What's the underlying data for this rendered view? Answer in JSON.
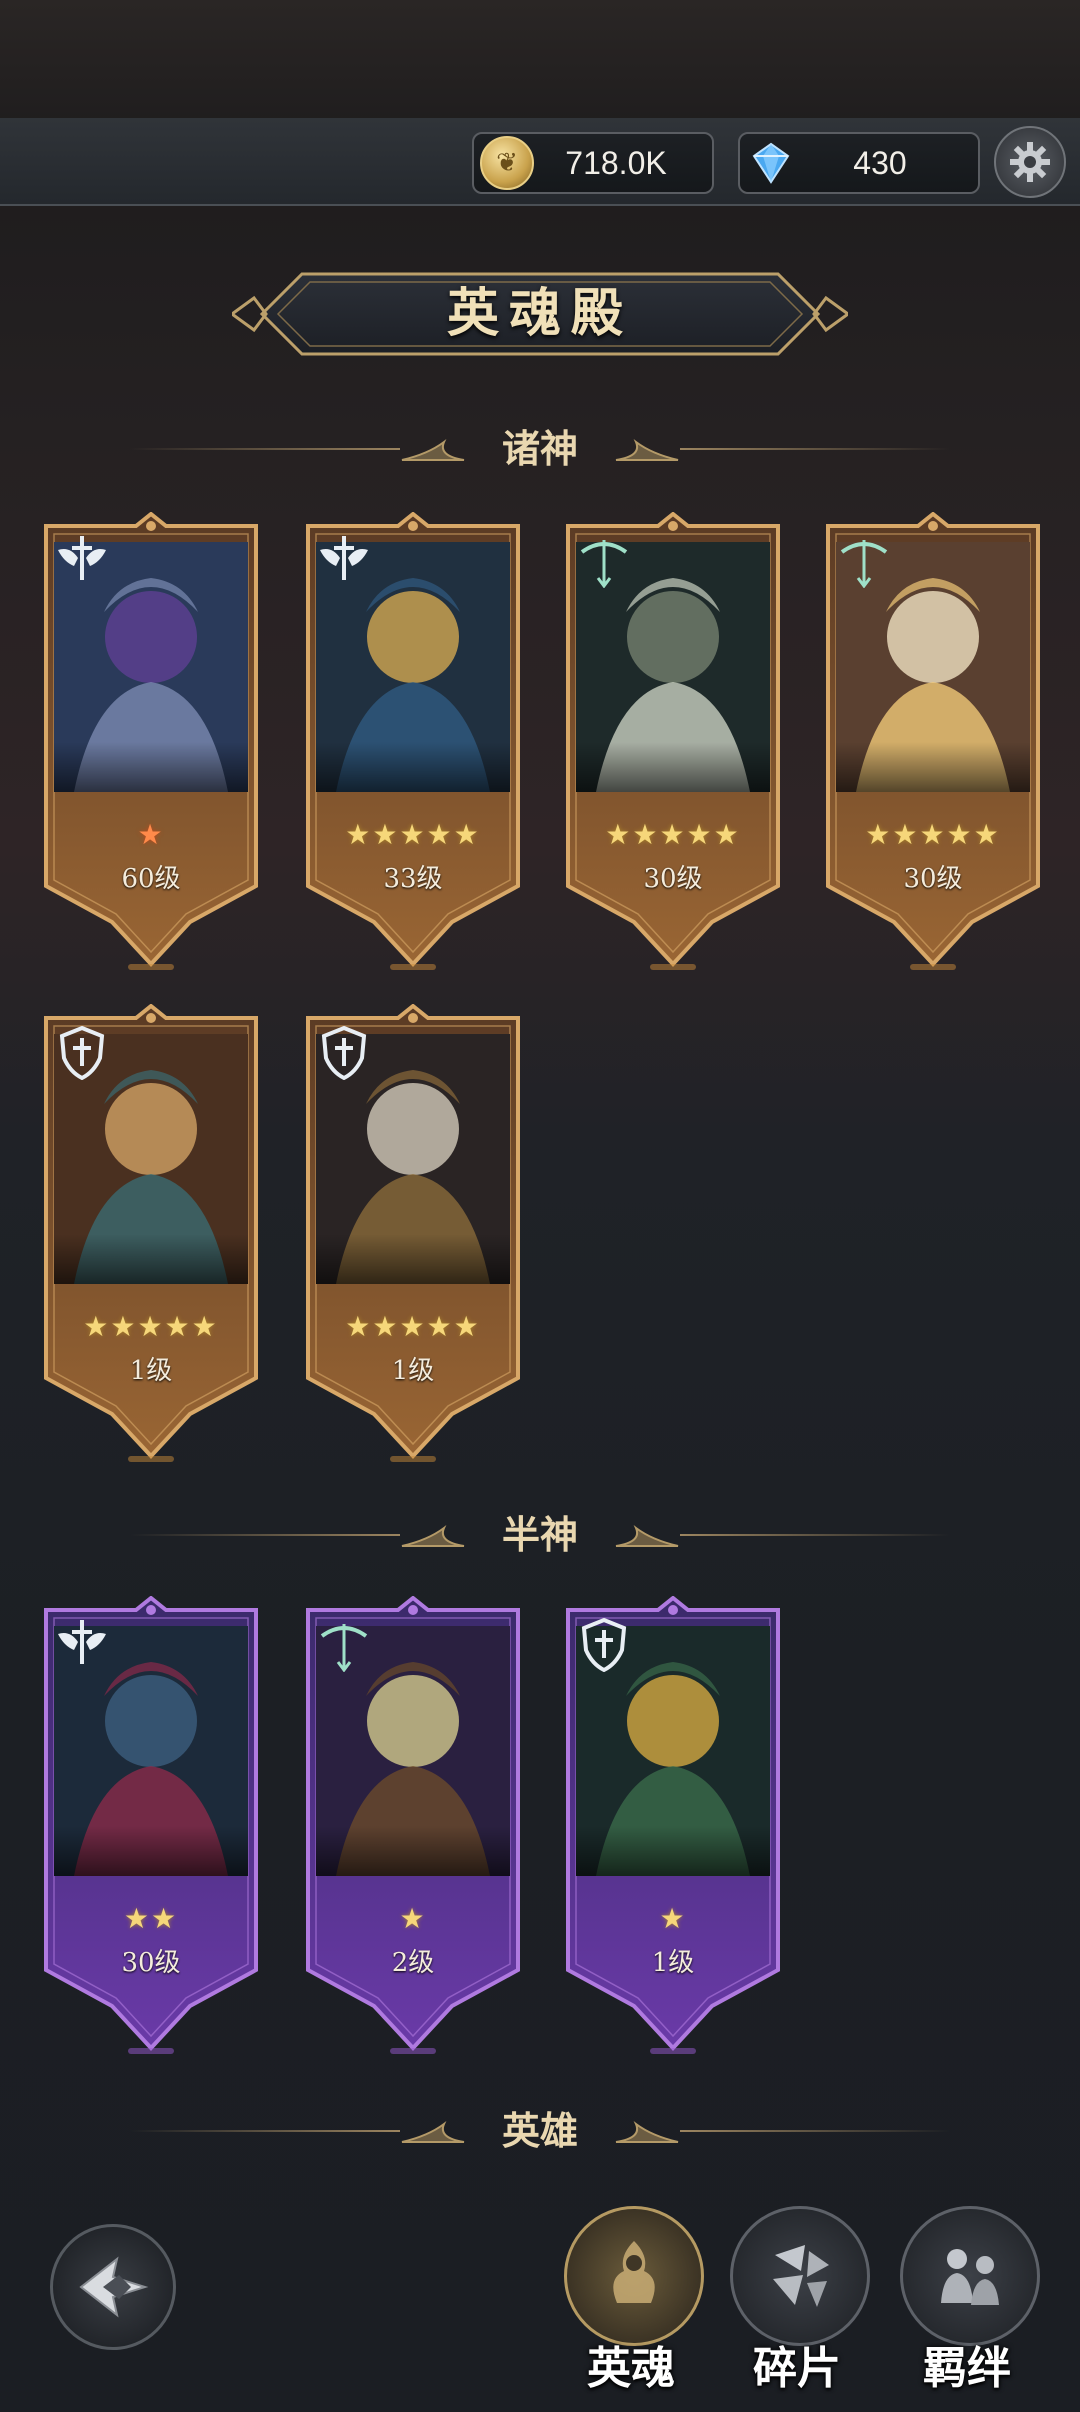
{
  "resources": {
    "coin": {
      "value": "718.0K",
      "icon": "coin-icon"
    },
    "gem": {
      "value": "430",
      "icon": "diamond-icon"
    }
  },
  "title": "英魂殿",
  "sections": {
    "gods": "诸神",
    "demigods": "半神",
    "heroes": "英雄"
  },
  "gods_cards": [
    {
      "stars": "★",
      "level": "60级",
      "class": "sword-wings-icon",
      "rarity": "gold",
      "star_color": "red"
    },
    {
      "stars": "★★★★★",
      "level": "33级",
      "class": "sword-wings-icon",
      "rarity": "gold",
      "star_color": "gold"
    },
    {
      "stars": "★★★★★",
      "level": "30级",
      "class": "bow-icon",
      "rarity": "gold",
      "star_color": "gold"
    },
    {
      "stars": "★★★★★",
      "level": "30级",
      "class": "bow-icon",
      "rarity": "gold",
      "star_color": "gold"
    },
    {
      "stars": "★★★★★",
      "level": "1级",
      "class": "shield-icon",
      "rarity": "gold",
      "star_color": "gold"
    },
    {
      "stars": "★★★★★",
      "level": "1级",
      "class": "shield-icon",
      "rarity": "gold",
      "star_color": "gold"
    }
  ],
  "demigod_cards": [
    {
      "stars": "★★",
      "level": "30级",
      "class": "sword-wings-icon",
      "rarity": "purple"
    },
    {
      "stars": "★",
      "level": "2级",
      "class": "bow-icon",
      "rarity": "purple"
    },
    {
      "stars": "★",
      "level": "1级",
      "class": "shield-icon",
      "rarity": "purple"
    }
  ],
  "nav": {
    "hero_soul": "英魂",
    "fragments": "碎片",
    "bonds": "羁绊"
  },
  "colors": {
    "gold_frame": "#c8944a",
    "purple_frame": "#8a4cc8",
    "accent_text": "#e9d7b0"
  }
}
